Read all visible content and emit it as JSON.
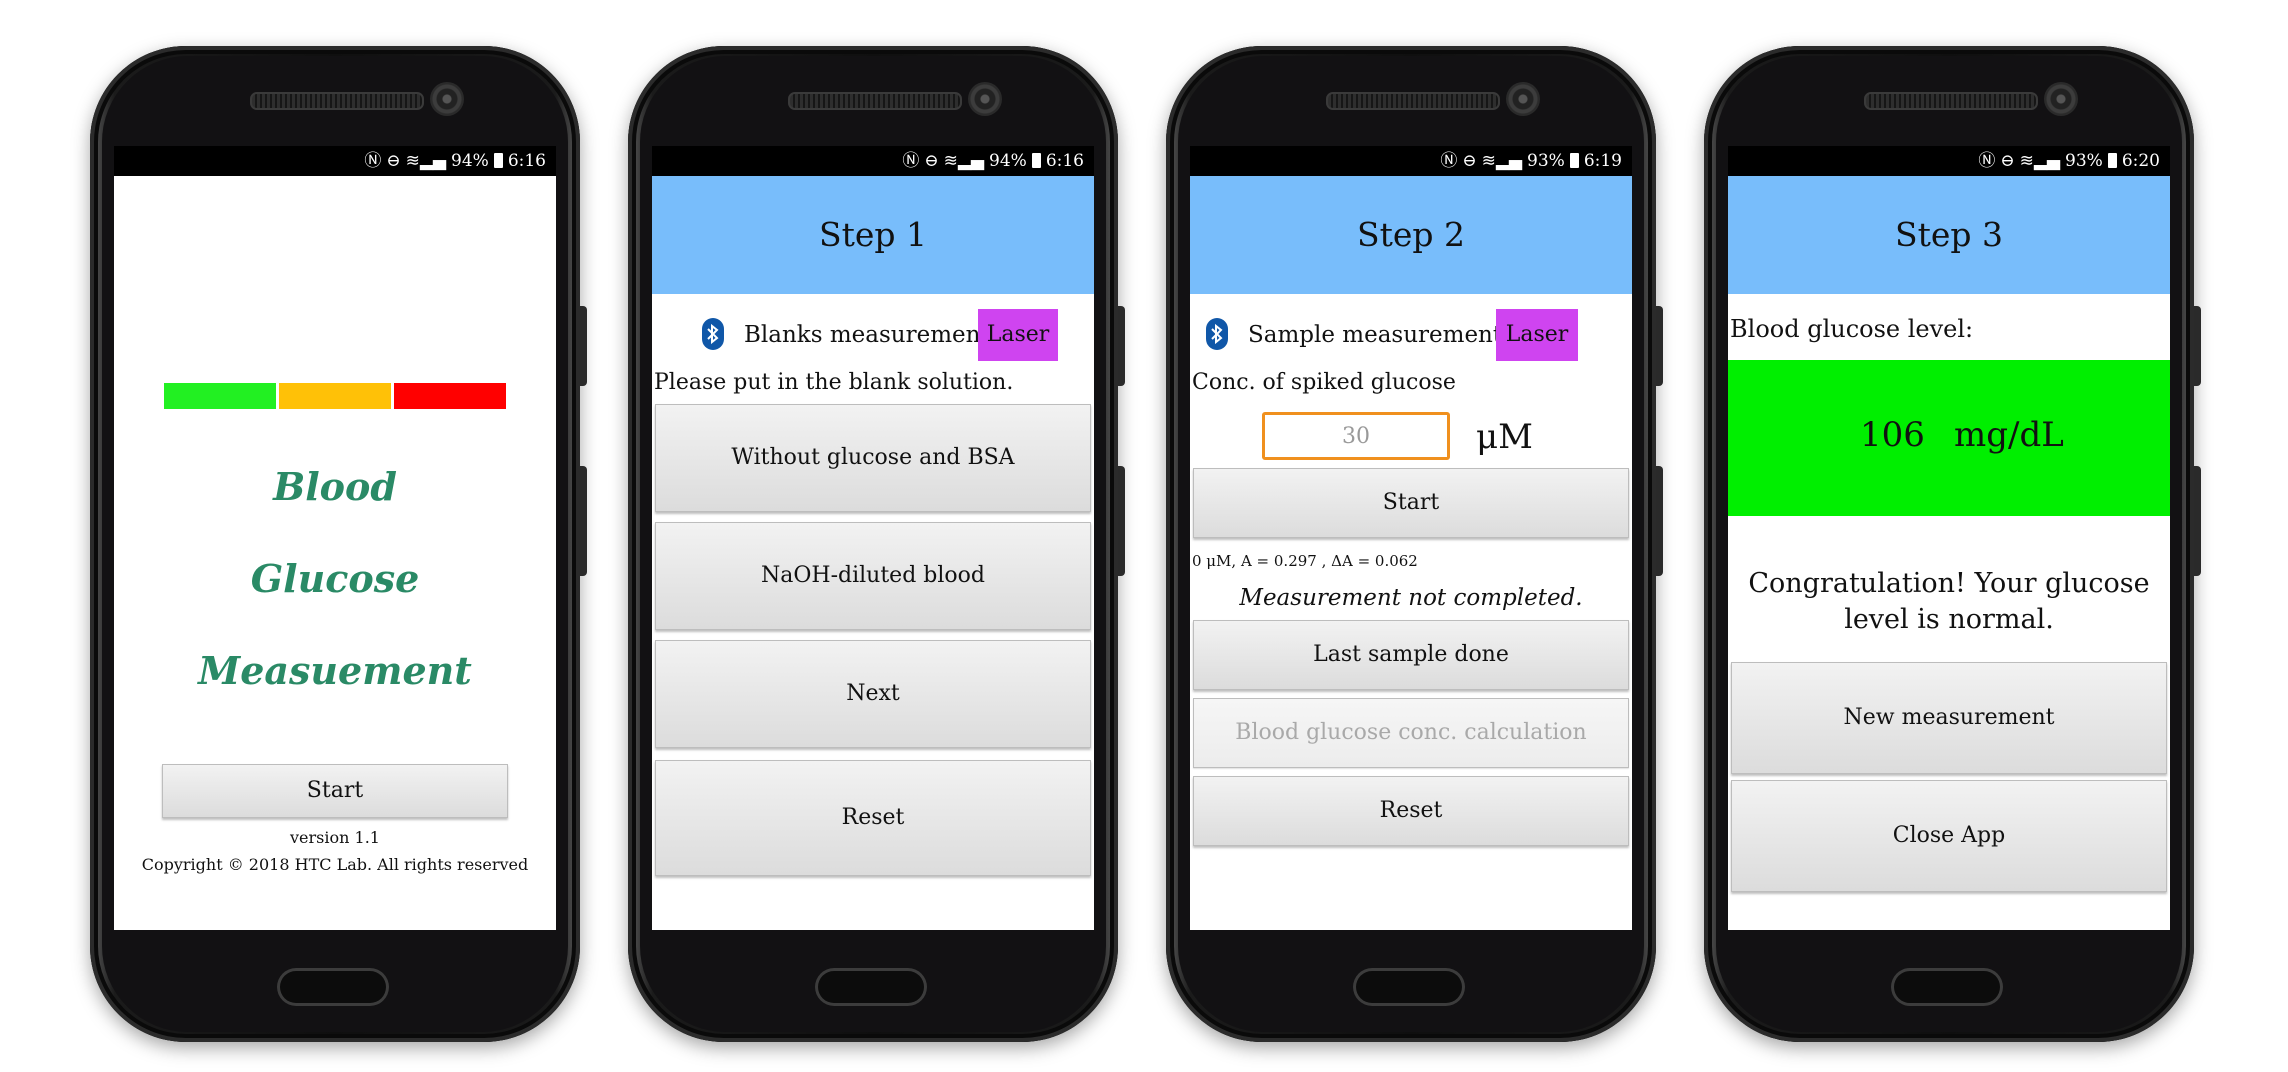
{
  "colors": {
    "header_blue": "#78bdfb",
    "laser_purple": "#cf44f0",
    "bar_green": "#22f022",
    "bar_yellow": "#ffc107",
    "bar_red": "#ff0000",
    "result_green": "#00ef00",
    "title_green": "#2a8a66",
    "input_border_orange": "#f0901e"
  },
  "phones": [
    {
      "status": {
        "battery": "94%",
        "time": "6:16"
      }
    },
    {
      "status": {
        "battery": "94%",
        "time": "6:16"
      }
    },
    {
      "status": {
        "battery": "93%",
        "time": "6:19"
      }
    },
    {
      "status": {
        "battery": "93%",
        "time": "6:20"
      }
    }
  ],
  "splash": {
    "title_line1": "Blood",
    "title_line2": "Glucose",
    "title_line3": "Measuement",
    "start_label": "Start",
    "version": "version 1.1",
    "copyright": "Copyright © 2018 HTC Lab. All rights reserved"
  },
  "step1": {
    "header": "Step 1",
    "measurement_label": "Blanks measurement:",
    "laser_label": "Laser",
    "instruction": "Please put in the blank solution.",
    "buttons": {
      "without_glucose": "Without glucose and BSA",
      "naoh_blood": "NaOH-diluted blood",
      "next": "Next",
      "reset": "Reset"
    }
  },
  "step2": {
    "header": "Step 2",
    "measurement_label": "Sample measurement:",
    "laser_label": "Laser",
    "conc_label": "Conc. of spiked glucose",
    "conc_value": "30",
    "unit": "μM",
    "start_label": "Start",
    "reading": "0 μM,  A = 0.297 , ΔA =  0.062",
    "status": "Measurement not completed.",
    "buttons": {
      "last_sample": "Last sample done",
      "calculation": "Blood glucose conc. calculation",
      "reset": "Reset"
    }
  },
  "step3": {
    "header": "Step 3",
    "level_label": "Blood glucose level:",
    "value": "106",
    "unit": "mg/dL",
    "message_line1": "Congratulation! Your glucose",
    "message_line2": "level is normal.",
    "buttons": {
      "new_measurement": "New measurement",
      "close_app": "Close App"
    }
  }
}
